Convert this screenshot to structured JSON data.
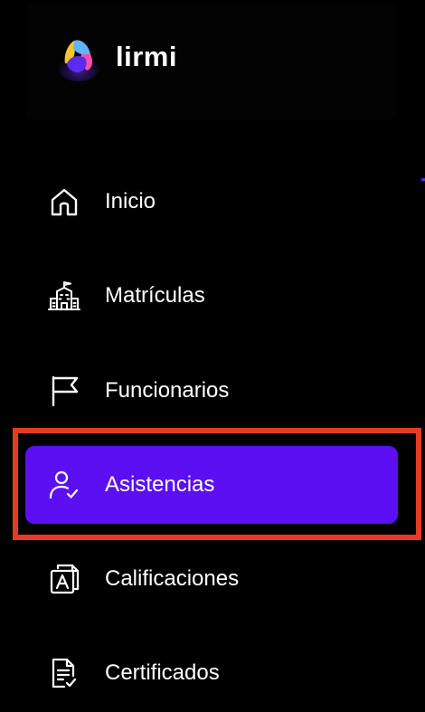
{
  "brand": {
    "name": "lirmi",
    "logo_icon": "lirmi-logo-icon"
  },
  "nav": {
    "items": [
      {
        "label": "Inicio",
        "icon": "home-icon",
        "active": false
      },
      {
        "label": "Matrículas",
        "icon": "school-building-icon",
        "active": false
      },
      {
        "label": "Funcionarios",
        "icon": "flag-icon",
        "active": false
      },
      {
        "label": "Asistencias",
        "icon": "user-check-icon",
        "active": true
      },
      {
        "label": "Calificaciones",
        "icon": "grades-document-icon",
        "active": false
      },
      {
        "label": "Certificados",
        "icon": "certificate-document-icon",
        "active": false
      }
    ]
  },
  "colors": {
    "background": "#000000",
    "active_item": "#5c0ff3",
    "highlight_border": "#e63b22",
    "text": "#ffffff"
  }
}
